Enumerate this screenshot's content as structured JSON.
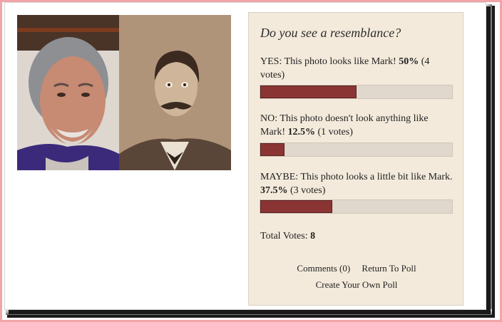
{
  "poll": {
    "question": "Do you see a resemblance?",
    "answers": [
      {
        "label": "YES: This photo looks like Mark!",
        "percent_text": "50%",
        "votes_text": "(4 votes)",
        "percent": 50
      },
      {
        "label": "NO: This photo doesn't look anything like Mark!",
        "percent_text": "12.5%",
        "votes_text": "(1 votes)",
        "percent": 12.5
      },
      {
        "label": "MAYBE: This photo looks a little bit like Mark.",
        "percent_text": "37.5%",
        "votes_text": "(3 votes)",
        "percent": 37.5
      }
    ],
    "total_label": "Total Votes:",
    "total_value": "8",
    "comments_link": "Comments (0)",
    "return_link": "Return To Poll",
    "create_link": "Create Your Own Poll"
  },
  "colors": {
    "bar_fill": "#8b3434",
    "bar_track": "#e0d8cc",
    "poll_bg": "#f3eadb",
    "frame_border": "#f2a5a8"
  }
}
